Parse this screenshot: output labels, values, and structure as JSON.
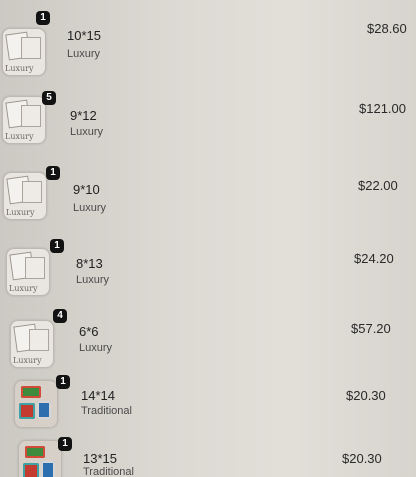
{
  "items": [
    {
      "quantity": "1",
      "size": "10*15",
      "type": "Luxury",
      "price": "$28.60",
      "thumb": "luxury-card-thumbnail"
    },
    {
      "quantity": "5",
      "size": "9*12",
      "type": "Luxury",
      "price": "$121.00",
      "thumb": "luxury-card-thumbnail"
    },
    {
      "quantity": "1",
      "size": "9*10",
      "type": "Luxury",
      "price": "$22.00",
      "thumb": "luxury-card-thumbnail"
    },
    {
      "quantity": "1",
      "size": "8*13",
      "type": "Luxury",
      "price": "$24.20",
      "thumb": "luxury-card-thumbnail"
    },
    {
      "quantity": "4",
      "size": "6*6",
      "type": "Luxury",
      "price": "$57.20",
      "thumb": "luxury-card-thumbnail"
    },
    {
      "quantity": "1",
      "size": "14*14",
      "type": "Traditional",
      "price": "$20.30",
      "thumb": "traditional-gift-thumbnail"
    },
    {
      "quantity": "1",
      "size": "13*15",
      "type": "Traditional",
      "price": "$20.30",
      "thumb": "traditional-gift-thumbnail"
    }
  ],
  "thumbnail_mark": "Luxury"
}
